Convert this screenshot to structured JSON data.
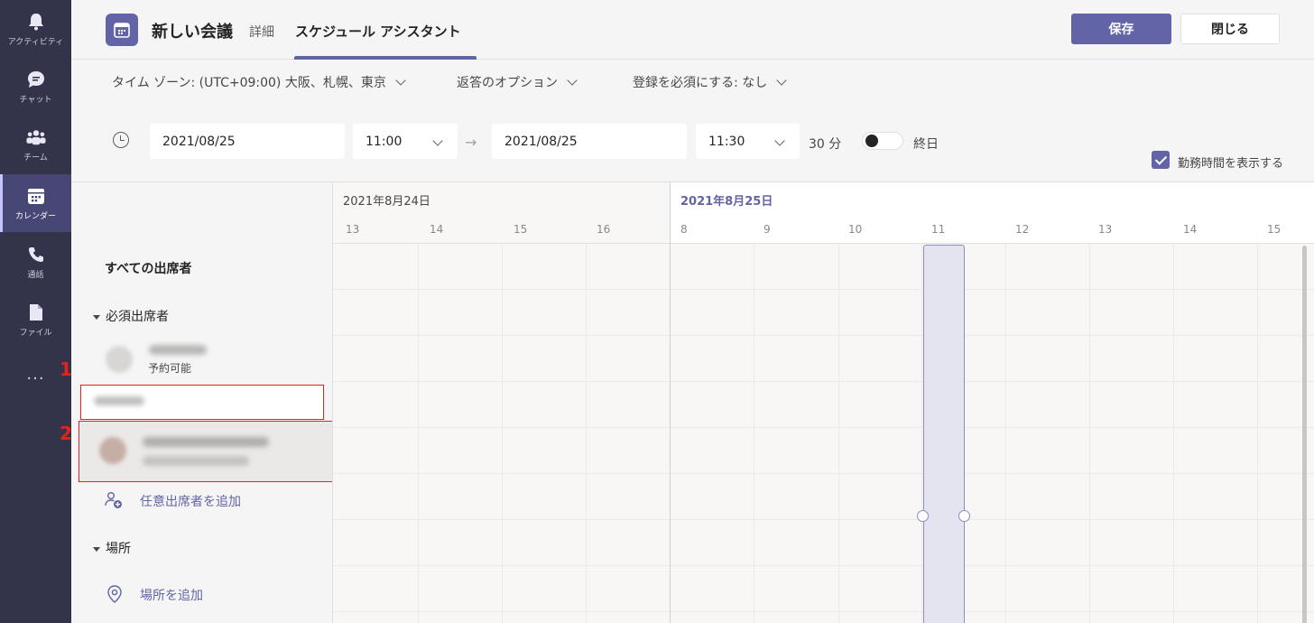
{
  "rail": {
    "items": [
      {
        "label": "アクティビティ",
        "icon": "bell-icon"
      },
      {
        "label": "チャット",
        "icon": "chat-icon"
      },
      {
        "label": "チーム",
        "icon": "teams-icon"
      },
      {
        "label": "カレンダー",
        "icon": "calendar-icon",
        "active": true
      },
      {
        "label": "通話",
        "icon": "phone-icon"
      },
      {
        "label": "ファイル",
        "icon": "file-icon"
      }
    ],
    "more": "..."
  },
  "header": {
    "title": "新しい会議",
    "tab_details": "詳細",
    "tab_scheduling": "スケジュール アシスタント",
    "save_label": "保存",
    "close_label": "閉じる"
  },
  "options": {
    "timezone": "タイム ゾーン: (UTC+09:00) 大阪、札幌、東京",
    "response": "返答のオプション",
    "registration": "登録を必須にする: なし"
  },
  "datetime": {
    "start_date": "2021/08/25",
    "start_time": "11:00",
    "end_date": "2021/08/25",
    "end_time": "11:30",
    "duration": "30 分",
    "all_day": "終日",
    "all_day_on": false,
    "show_working_hours": "勤務時間を表示する",
    "show_working_hours_checked": true
  },
  "attendees": {
    "all": "すべての出席者",
    "required_section": "必須出席者",
    "required_status": "予約可能",
    "add_optional": "任意出席者を追加",
    "location_section": "場所",
    "add_location": "場所を追加"
  },
  "annotations": {
    "callout_1": "1",
    "callout_2": "2"
  },
  "grid": {
    "day1": "2021年8月24日",
    "day2": "2021年8月25日",
    "day1_hours": [
      "13",
      "14",
      "15",
      "16"
    ],
    "day2_hours": [
      "8",
      "9",
      "10",
      "11",
      "12",
      "13",
      "14",
      "15"
    ]
  },
  "colors": {
    "accent": "#6264a7",
    "rail": "#33344a",
    "annotation": "#e8221a"
  }
}
